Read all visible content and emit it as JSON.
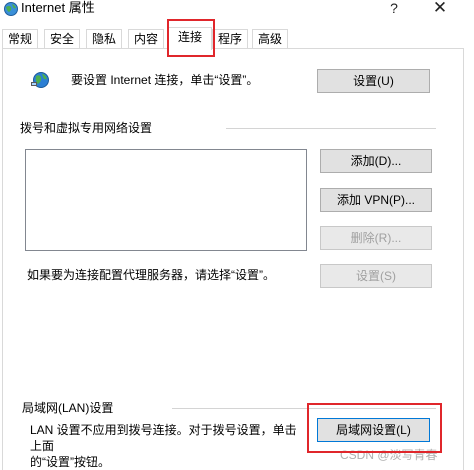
{
  "window": {
    "title": "Internet 属性",
    "help_glyph": "?",
    "close_glyph": "✕"
  },
  "tabs": [
    {
      "label": "常规"
    },
    {
      "label": "安全"
    },
    {
      "label": "隐私"
    },
    {
      "label": "内容"
    },
    {
      "label": "连接",
      "active": true
    },
    {
      "label": "程序"
    },
    {
      "label": "高级"
    }
  ],
  "setup": {
    "text": "要设置 Internet 连接，单击“设置”。",
    "button": "设置(U)"
  },
  "dialup": {
    "group_label": "拨号和虚拟专用网络设置",
    "add_button": "添加(D)...",
    "add_vpn_button": "添加 VPN(P)...",
    "delete_button": "删除(R)...",
    "proxy_text": "如果要为连接配置代理服务器，请选择“设置”。",
    "settings_button": "设置(S)"
  },
  "lan": {
    "group_label": "局域网(LAN)设置",
    "description_line1": "LAN 设置不应用到拨号连接。对于拨号设置，单击上面",
    "description_line2": "的“设置”按钮。",
    "button": "局域网设置(L)"
  },
  "watermark": "CSDN @淡写青春",
  "colors": {
    "highlight": "#e0262b",
    "button_face": "#e1e1e1",
    "default_border": "#0078d7"
  },
  "icons": {
    "title": "internet-options-globe-icon",
    "setup": "globe-network-icon"
  }
}
